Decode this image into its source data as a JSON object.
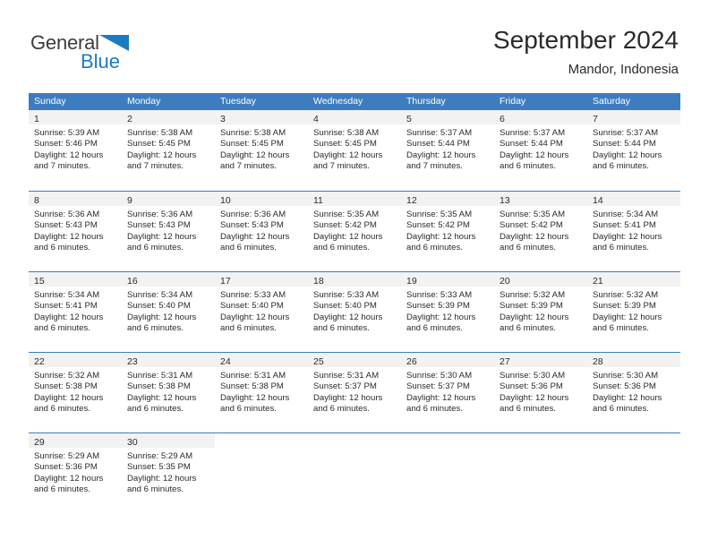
{
  "brand": {
    "name_part1": "General",
    "name_part2": "Blue",
    "flag_icon": "blue-triangle-flag-icon",
    "blue_hex": "#1b7ac4"
  },
  "header": {
    "title": "September 2024",
    "location": "Mandor, Indonesia"
  },
  "calendar": {
    "header_bg_hex": "#3d7dbf",
    "date_band_hex": "#f2f2f2",
    "day_names": [
      "Sunday",
      "Monday",
      "Tuesday",
      "Wednesday",
      "Thursday",
      "Friday",
      "Saturday"
    ],
    "weeks": [
      [
        {
          "date": "1",
          "sunrise": "Sunrise: 5:39 AM",
          "sunset": "Sunset: 5:46 PM",
          "daylight1": "Daylight: 12 hours",
          "daylight2": "and 7 minutes."
        },
        {
          "date": "2",
          "sunrise": "Sunrise: 5:38 AM",
          "sunset": "Sunset: 5:45 PM",
          "daylight1": "Daylight: 12 hours",
          "daylight2": "and 7 minutes."
        },
        {
          "date": "3",
          "sunrise": "Sunrise: 5:38 AM",
          "sunset": "Sunset: 5:45 PM",
          "daylight1": "Daylight: 12 hours",
          "daylight2": "and 7 minutes."
        },
        {
          "date": "4",
          "sunrise": "Sunrise: 5:38 AM",
          "sunset": "Sunset: 5:45 PM",
          "daylight1": "Daylight: 12 hours",
          "daylight2": "and 7 minutes."
        },
        {
          "date": "5",
          "sunrise": "Sunrise: 5:37 AM",
          "sunset": "Sunset: 5:44 PM",
          "daylight1": "Daylight: 12 hours",
          "daylight2": "and 7 minutes."
        },
        {
          "date": "6",
          "sunrise": "Sunrise: 5:37 AM",
          "sunset": "Sunset: 5:44 PM",
          "daylight1": "Daylight: 12 hours",
          "daylight2": "and 6 minutes."
        },
        {
          "date": "7",
          "sunrise": "Sunrise: 5:37 AM",
          "sunset": "Sunset: 5:44 PM",
          "daylight1": "Daylight: 12 hours",
          "daylight2": "and 6 minutes."
        }
      ],
      [
        {
          "date": "8",
          "sunrise": "Sunrise: 5:36 AM",
          "sunset": "Sunset: 5:43 PM",
          "daylight1": "Daylight: 12 hours",
          "daylight2": "and 6 minutes."
        },
        {
          "date": "9",
          "sunrise": "Sunrise: 5:36 AM",
          "sunset": "Sunset: 5:43 PM",
          "daylight1": "Daylight: 12 hours",
          "daylight2": "and 6 minutes."
        },
        {
          "date": "10",
          "sunrise": "Sunrise: 5:36 AM",
          "sunset": "Sunset: 5:43 PM",
          "daylight1": "Daylight: 12 hours",
          "daylight2": "and 6 minutes."
        },
        {
          "date": "11",
          "sunrise": "Sunrise: 5:35 AM",
          "sunset": "Sunset: 5:42 PM",
          "daylight1": "Daylight: 12 hours",
          "daylight2": "and 6 minutes."
        },
        {
          "date": "12",
          "sunrise": "Sunrise: 5:35 AM",
          "sunset": "Sunset: 5:42 PM",
          "daylight1": "Daylight: 12 hours",
          "daylight2": "and 6 minutes."
        },
        {
          "date": "13",
          "sunrise": "Sunrise: 5:35 AM",
          "sunset": "Sunset: 5:42 PM",
          "daylight1": "Daylight: 12 hours",
          "daylight2": "and 6 minutes."
        },
        {
          "date": "14",
          "sunrise": "Sunrise: 5:34 AM",
          "sunset": "Sunset: 5:41 PM",
          "daylight1": "Daylight: 12 hours",
          "daylight2": "and 6 minutes."
        }
      ],
      [
        {
          "date": "15",
          "sunrise": "Sunrise: 5:34 AM",
          "sunset": "Sunset: 5:41 PM",
          "daylight1": "Daylight: 12 hours",
          "daylight2": "and 6 minutes."
        },
        {
          "date": "16",
          "sunrise": "Sunrise: 5:34 AM",
          "sunset": "Sunset: 5:40 PM",
          "daylight1": "Daylight: 12 hours",
          "daylight2": "and 6 minutes."
        },
        {
          "date": "17",
          "sunrise": "Sunrise: 5:33 AM",
          "sunset": "Sunset: 5:40 PM",
          "daylight1": "Daylight: 12 hours",
          "daylight2": "and 6 minutes."
        },
        {
          "date": "18",
          "sunrise": "Sunrise: 5:33 AM",
          "sunset": "Sunset: 5:40 PM",
          "daylight1": "Daylight: 12 hours",
          "daylight2": "and 6 minutes."
        },
        {
          "date": "19",
          "sunrise": "Sunrise: 5:33 AM",
          "sunset": "Sunset: 5:39 PM",
          "daylight1": "Daylight: 12 hours",
          "daylight2": "and 6 minutes."
        },
        {
          "date": "20",
          "sunrise": "Sunrise: 5:32 AM",
          "sunset": "Sunset: 5:39 PM",
          "daylight1": "Daylight: 12 hours",
          "daylight2": "and 6 minutes."
        },
        {
          "date": "21",
          "sunrise": "Sunrise: 5:32 AM",
          "sunset": "Sunset: 5:39 PM",
          "daylight1": "Daylight: 12 hours",
          "daylight2": "and 6 minutes."
        }
      ],
      [
        {
          "date": "22",
          "sunrise": "Sunrise: 5:32 AM",
          "sunset": "Sunset: 5:38 PM",
          "daylight1": "Daylight: 12 hours",
          "daylight2": "and 6 minutes."
        },
        {
          "date": "23",
          "sunrise": "Sunrise: 5:31 AM",
          "sunset": "Sunset: 5:38 PM",
          "daylight1": "Daylight: 12 hours",
          "daylight2": "and 6 minutes."
        },
        {
          "date": "24",
          "sunrise": "Sunrise: 5:31 AM",
          "sunset": "Sunset: 5:38 PM",
          "daylight1": "Daylight: 12 hours",
          "daylight2": "and 6 minutes."
        },
        {
          "date": "25",
          "sunrise": "Sunrise: 5:31 AM",
          "sunset": "Sunset: 5:37 PM",
          "daylight1": "Daylight: 12 hours",
          "daylight2": "and 6 minutes."
        },
        {
          "date": "26",
          "sunrise": "Sunrise: 5:30 AM",
          "sunset": "Sunset: 5:37 PM",
          "daylight1": "Daylight: 12 hours",
          "daylight2": "and 6 minutes."
        },
        {
          "date": "27",
          "sunrise": "Sunrise: 5:30 AM",
          "sunset": "Sunset: 5:36 PM",
          "daylight1": "Daylight: 12 hours",
          "daylight2": "and 6 minutes."
        },
        {
          "date": "28",
          "sunrise": "Sunrise: 5:30 AM",
          "sunset": "Sunset: 5:36 PM",
          "daylight1": "Daylight: 12 hours",
          "daylight2": "and 6 minutes."
        }
      ],
      [
        {
          "date": "29",
          "sunrise": "Sunrise: 5:29 AM",
          "sunset": "Sunset: 5:36 PM",
          "daylight1": "Daylight: 12 hours",
          "daylight2": "and 6 minutes."
        },
        {
          "date": "30",
          "sunrise": "Sunrise: 5:29 AM",
          "sunset": "Sunset: 5:35 PM",
          "daylight1": "Daylight: 12 hours",
          "daylight2": "and 6 minutes."
        },
        {
          "date": "",
          "sunrise": "",
          "sunset": "",
          "daylight1": "",
          "daylight2": ""
        },
        {
          "date": "",
          "sunrise": "",
          "sunset": "",
          "daylight1": "",
          "daylight2": ""
        },
        {
          "date": "",
          "sunrise": "",
          "sunset": "",
          "daylight1": "",
          "daylight2": ""
        },
        {
          "date": "",
          "sunrise": "",
          "sunset": "",
          "daylight1": "",
          "daylight2": ""
        },
        {
          "date": "",
          "sunrise": "",
          "sunset": "",
          "daylight1": "",
          "daylight2": ""
        }
      ]
    ]
  }
}
